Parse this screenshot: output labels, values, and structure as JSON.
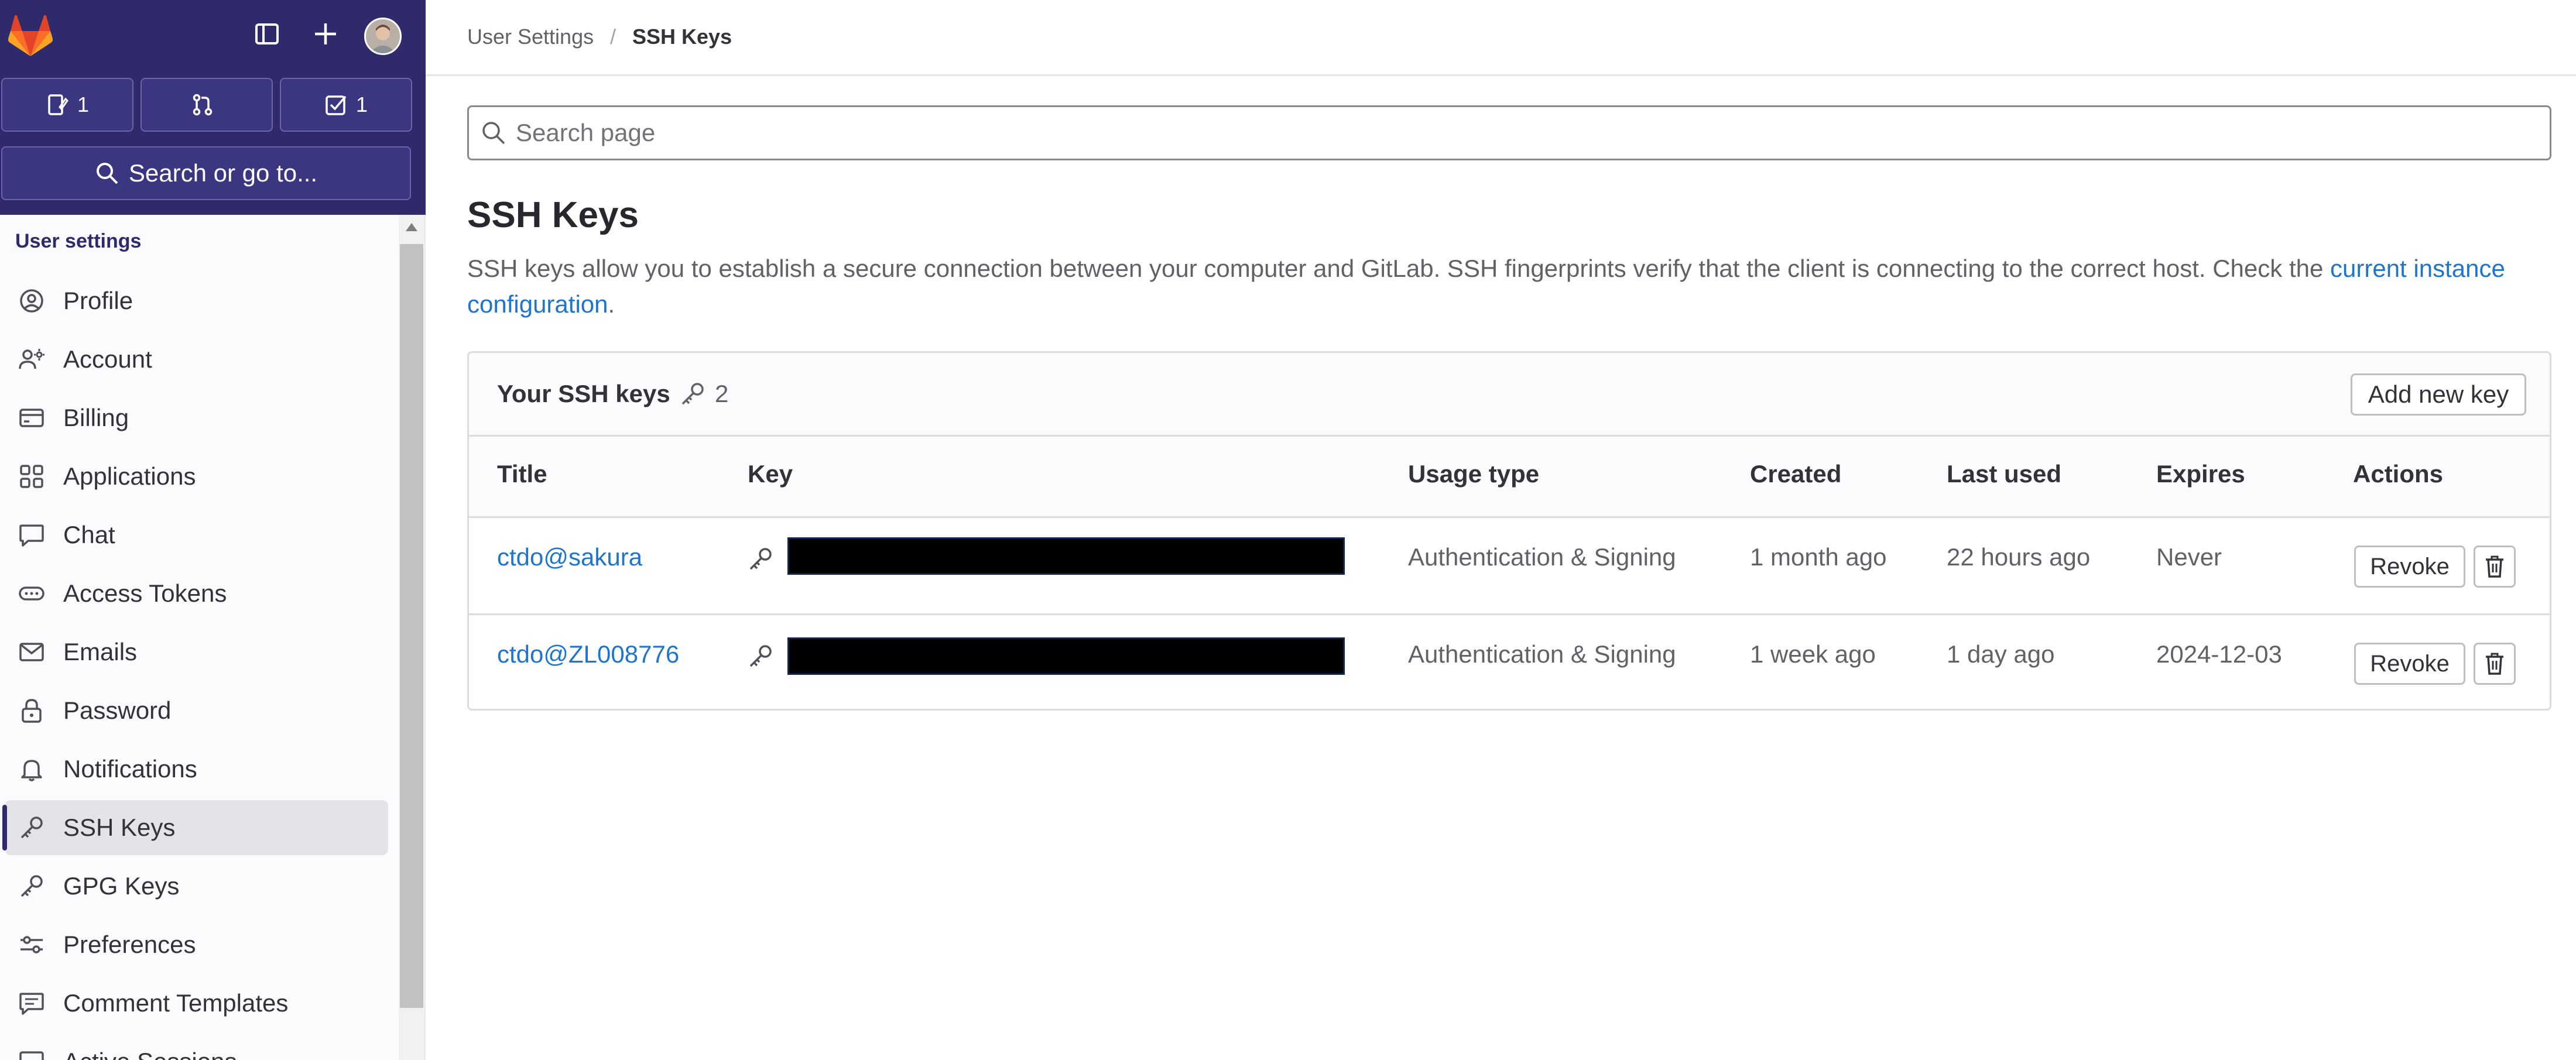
{
  "top": {
    "issues_count": "1",
    "merge_requests_count": "",
    "todos_count": "1",
    "search_label": "Search or go to..."
  },
  "sidebar": {
    "heading": "User settings",
    "items": [
      {
        "label": "Profile",
        "icon": "profile-icon"
      },
      {
        "label": "Account",
        "icon": "account-icon"
      },
      {
        "label": "Billing",
        "icon": "credit-card-icon"
      },
      {
        "label": "Applications",
        "icon": "applications-icon"
      },
      {
        "label": "Chat",
        "icon": "comment-icon"
      },
      {
        "label": "Access Tokens",
        "icon": "token-icon"
      },
      {
        "label": "Emails",
        "icon": "mail-icon"
      },
      {
        "label": "Password",
        "icon": "lock-icon"
      },
      {
        "label": "Notifications",
        "icon": "bell-icon"
      },
      {
        "label": "SSH Keys",
        "icon": "key-icon",
        "active": true
      },
      {
        "label": "GPG Keys",
        "icon": "key-icon"
      },
      {
        "label": "Preferences",
        "icon": "preferences-icon"
      },
      {
        "label": "Comment Templates",
        "icon": "comment-lines-icon"
      },
      {
        "label": "Active Sessions",
        "icon": "monitor-icon"
      }
    ]
  },
  "breadcrumb": {
    "parent": "User Settings",
    "separator": "/",
    "current": "SSH Keys"
  },
  "search": {
    "placeholder": "Search page",
    "value": ""
  },
  "page": {
    "title": "SSH Keys",
    "description": "SSH keys allow you to establish a secure connection between your computer and GitLab. SSH fingerprints verify that the client is connecting to the correct host. Check the",
    "link_text": "current instance configuration",
    "description_end": "."
  },
  "keys_card": {
    "title": "Your SSH keys",
    "count": "2",
    "add_button": "Add new key",
    "columns": [
      "Title",
      "Key",
      "Usage type",
      "Created",
      "Last used",
      "Expires",
      "Actions"
    ],
    "rows": [
      {
        "title": "ctdo@sakura",
        "usage": "Authentication & Signing",
        "created": "1 month ago",
        "last_used": "22 hours ago",
        "expires": "Never",
        "revoke": "Revoke"
      },
      {
        "title": "ctdo@ZL008776",
        "usage": "Authentication & Signing",
        "created": "1 week ago",
        "last_used": "1 day ago",
        "expires": "2024-12-03",
        "revoke": "Revoke"
      }
    ]
  },
  "colors": {
    "sidebar_top": "#2f2a6b",
    "link": "#1f75cb",
    "logo_orange": "#fc6d26"
  }
}
